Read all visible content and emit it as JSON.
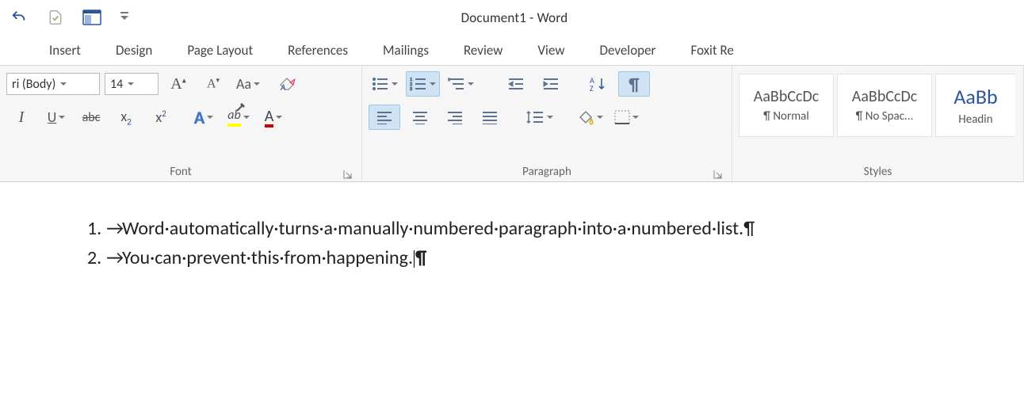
{
  "app": {
    "title": "Document1 - Word"
  },
  "tabs": {
    "insert": "Insert",
    "design": "Design",
    "page_layout": "Page Layout",
    "references": "References",
    "mailings": "Mailings",
    "review": "Review",
    "view": "View",
    "developer": "Developer",
    "foxit": "Foxit Re"
  },
  "font": {
    "name": "ri (Body)",
    "size": "14",
    "aa": "Aa",
    "group_label": "Font"
  },
  "paragraph": {
    "group_label": "Paragraph"
  },
  "styles": {
    "group_label": "Styles",
    "normal_preview": "AaBbCcDc",
    "normal_label": "¶ Normal",
    "nospace_preview": "AaBbCcDc",
    "nospace_label": "¶ No Spac...",
    "heading_preview": "AaBb",
    "heading_label": "Headin"
  },
  "doc": {
    "item1_num": "1.",
    "item1_text": "Word·automatically·turns·a·manually·numbered·paragraph·into·a·numbered·list.¶",
    "item2_num": "2.",
    "item2_text_a": "You·can·prevent·this·from·happening.",
    "item2_text_b": "¶"
  }
}
